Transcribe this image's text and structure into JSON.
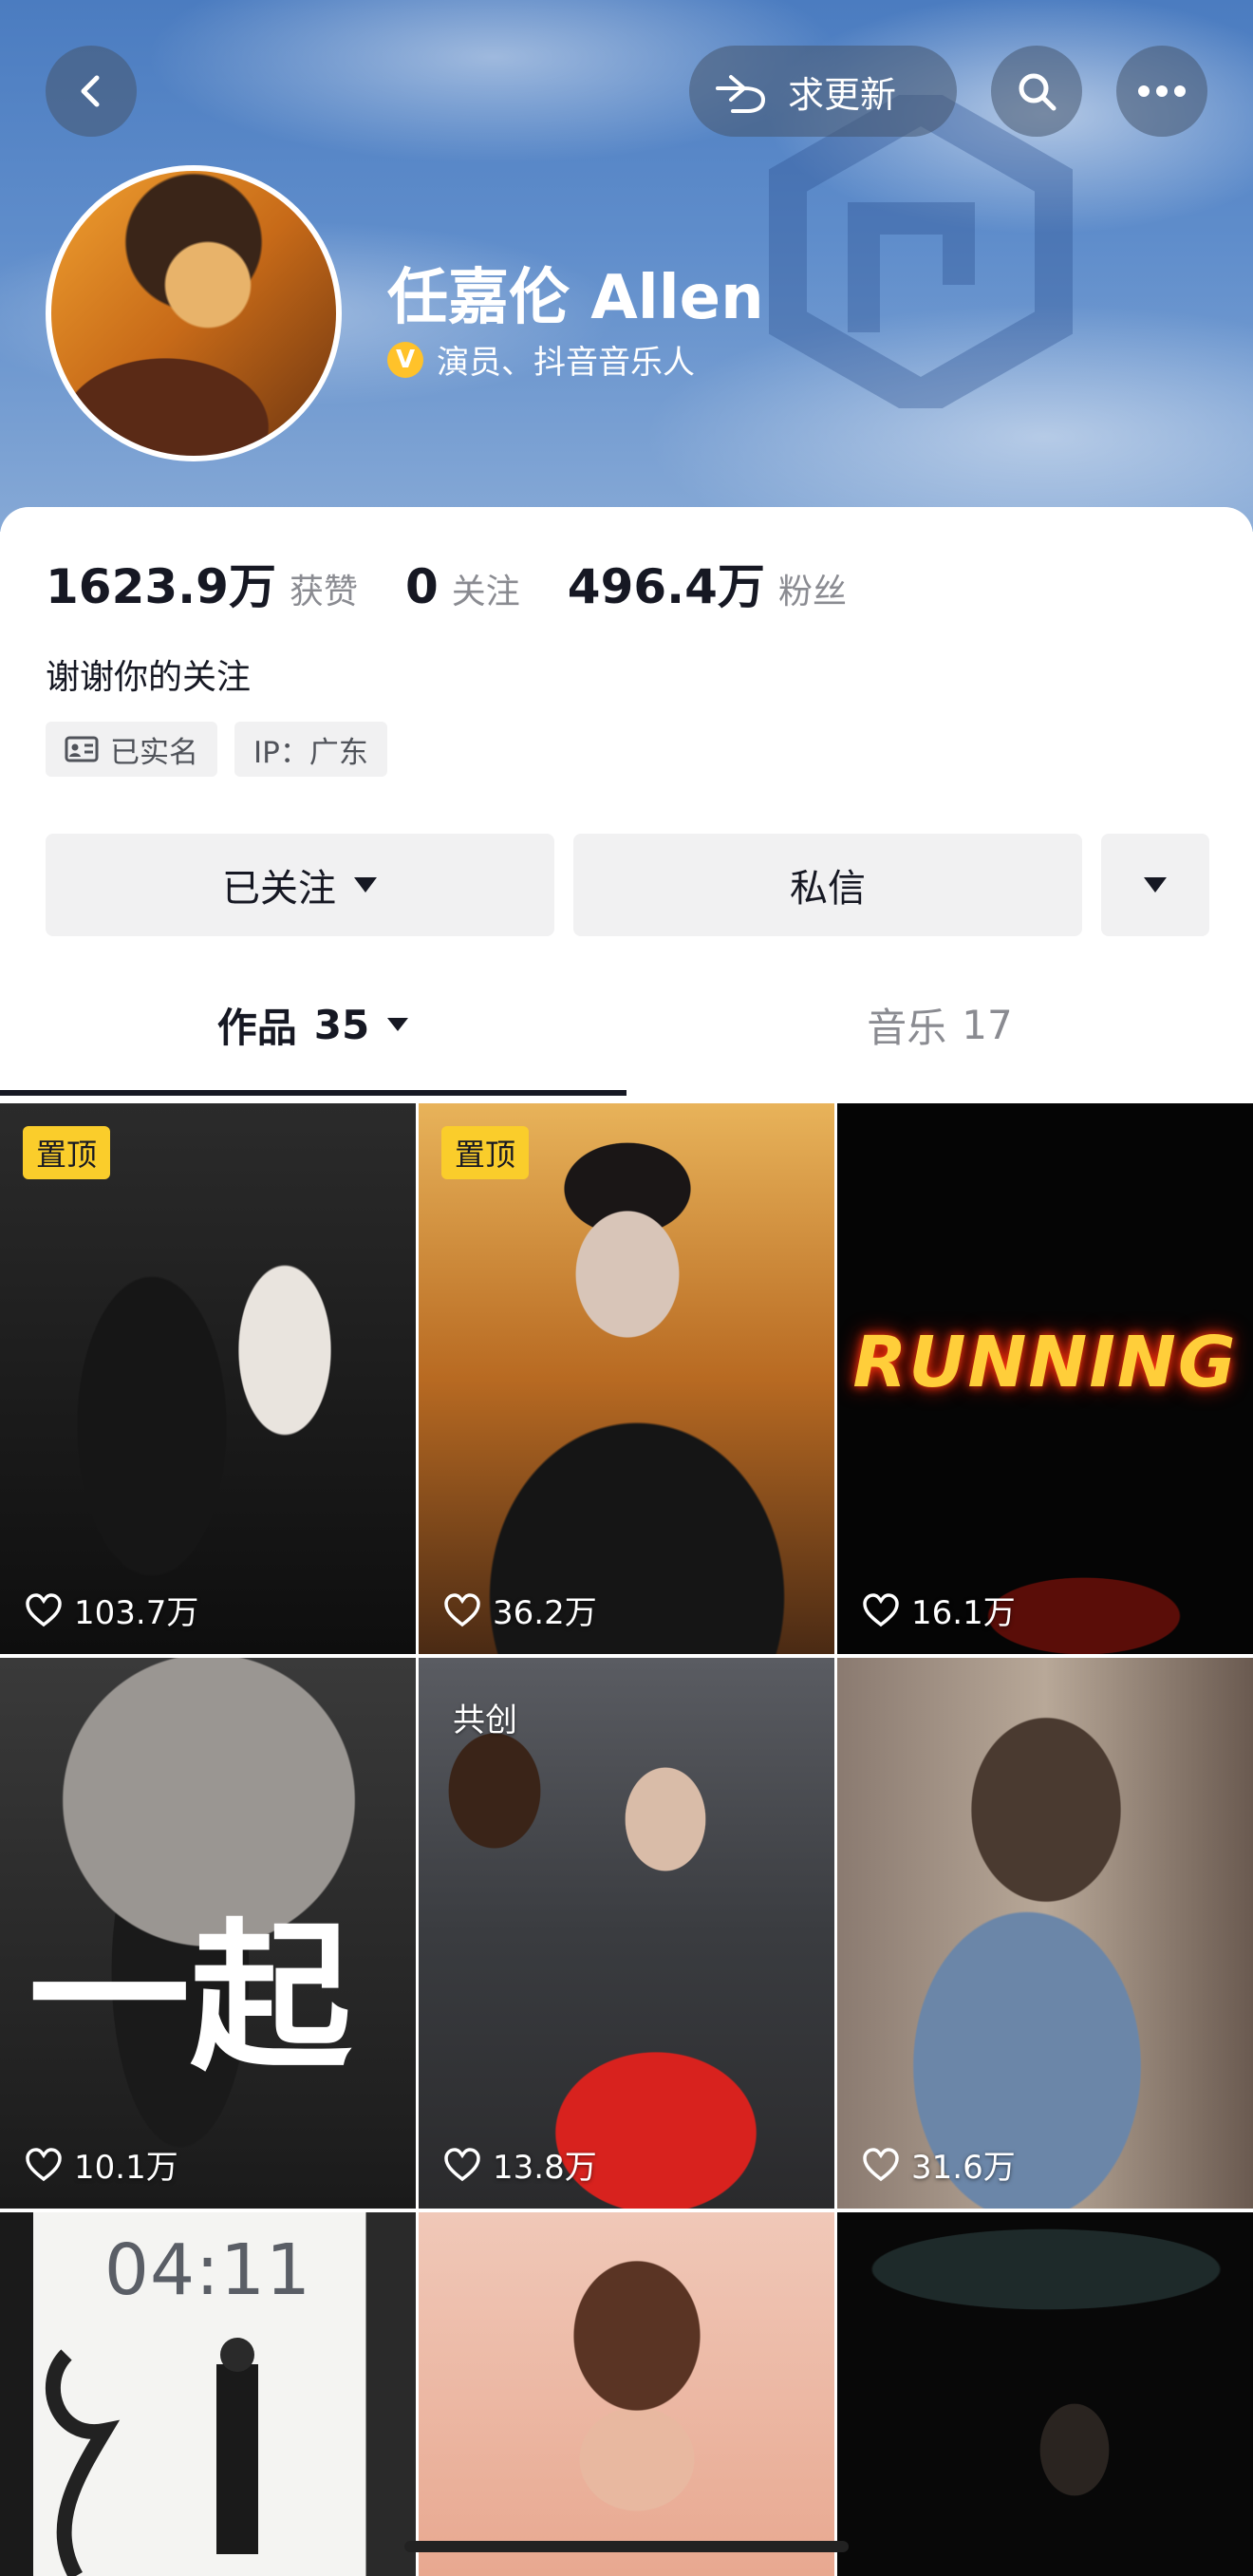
{
  "header": {
    "update_label": "求更新",
    "name": "任嘉伦 Allen",
    "verification": "演员、抖音音乐人",
    "verify_badge": "V"
  },
  "stats": [
    {
      "value": "1623.9万",
      "unit": "获赞"
    },
    {
      "value": "0",
      "unit": "关注"
    },
    {
      "value": "496.4万",
      "unit": "粉丝"
    }
  ],
  "bio": "谢谢你的关注",
  "tags": {
    "realname": "已实名",
    "ip": "IP：广东"
  },
  "actions": {
    "follow": "已关注",
    "message": "私信"
  },
  "tabs": {
    "works_label": "作品",
    "works_count": "35",
    "music_label": "音乐",
    "music_count": "17"
  },
  "videos": [
    {
      "badge": "置顶",
      "likes": "103.7万"
    },
    {
      "badge": "置顶",
      "likes": "36.2万"
    },
    {
      "overlay": "RUNNING",
      "likes": "16.1万"
    },
    {
      "overlay": "一起",
      "likes": "10.1万"
    },
    {
      "badge": "共创",
      "likes": "13.8万"
    },
    {
      "likes": "31.6万"
    },
    {
      "overlay": "04:11"
    },
    {},
    {}
  ],
  "colors": {
    "pin_badge": "#facd2b",
    "verify": "#ffc22a",
    "text_primary": "#161823",
    "text_secondary": "#8a8b91",
    "button_bg": "#f1f1f2"
  }
}
